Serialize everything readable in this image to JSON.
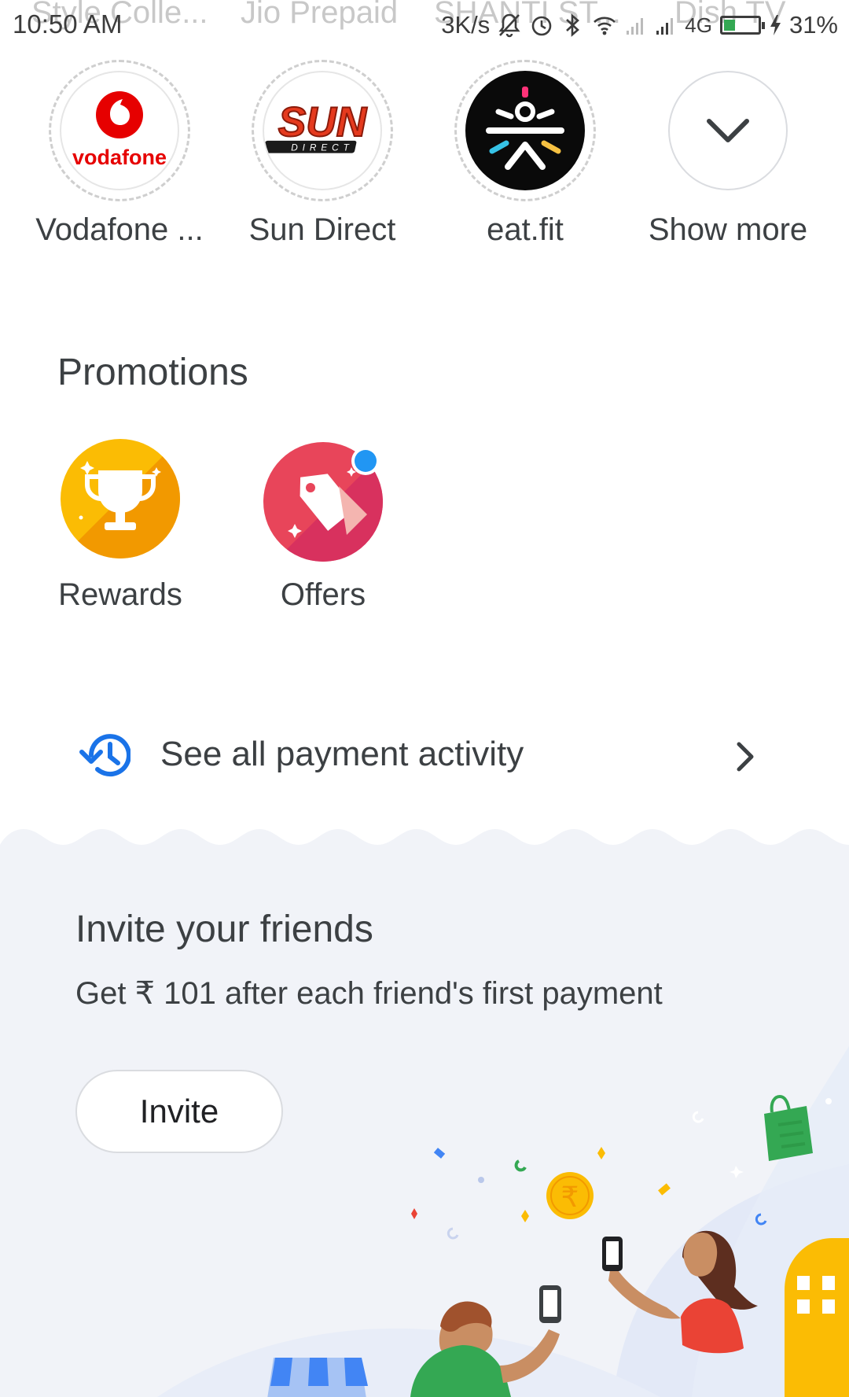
{
  "status_bar": {
    "time": "10:50 AM",
    "speed": "3K/s",
    "network": "4G",
    "battery_text": "31%",
    "battery_level": 0.31,
    "background_labels": [
      "Style Colle...",
      "Jio Prepaid",
      "SHANTI ST...",
      "Dish TV"
    ]
  },
  "billers": [
    {
      "label": "Vodafone ...",
      "logo": "vodafone-logo",
      "logo_text": "vodafone"
    },
    {
      "label": "Sun Direct",
      "logo": "sun-direct-logo",
      "logo_text": "SUN",
      "logo_subtext": "DIRECT"
    },
    {
      "label": "eat.fit",
      "logo": "eatfit-logo"
    },
    {
      "label": "Show more",
      "logo": "chevron-down-icon"
    }
  ],
  "promotions": {
    "title": "Promotions",
    "items": [
      {
        "label": "Rewards",
        "icon": "trophy-icon",
        "color": "#f9a825"
      },
      {
        "label": "Offers",
        "icon": "tag-icon",
        "color": "#e8455a"
      }
    ]
  },
  "activity": {
    "label": "See all payment activity",
    "icon": "history-icon",
    "icon_color": "#1a73e8"
  },
  "invite": {
    "title": "Invite your friends",
    "subtitle": "Get ₹ 101 after each friend's first payment",
    "button_label": "Invite",
    "coin_symbol": "₹"
  }
}
